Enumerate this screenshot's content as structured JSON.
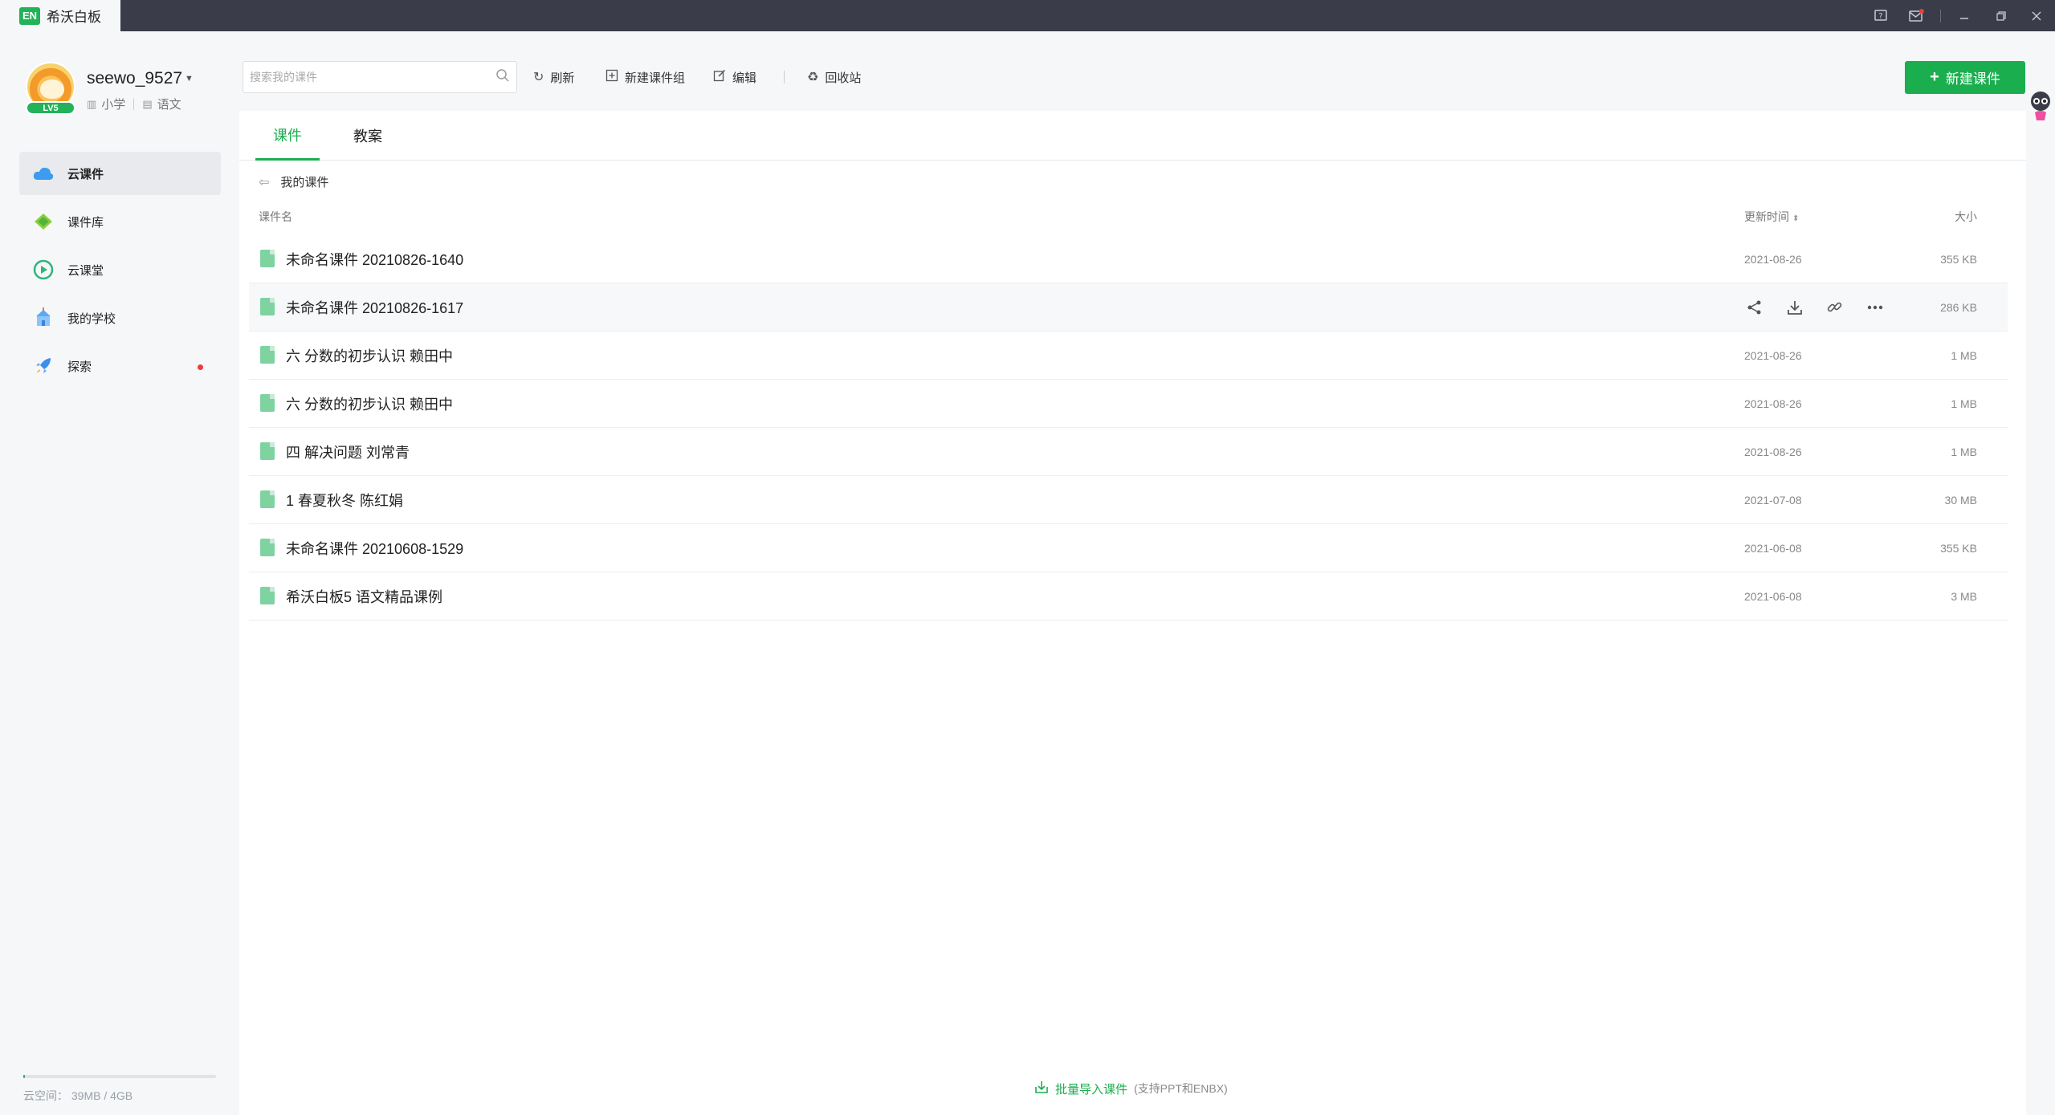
{
  "app": {
    "logo_text": "EN",
    "title": "希沃白板"
  },
  "user": {
    "name": "seewo_9527",
    "level": "LV5",
    "grade": "小学",
    "subject": "语文"
  },
  "sidebar": {
    "items": [
      {
        "label": "云课件",
        "active": true
      },
      {
        "label": "课件库"
      },
      {
        "label": "云课堂"
      },
      {
        "label": "我的学校"
      },
      {
        "label": "探索",
        "badge": true
      }
    ],
    "storage_text": "云空间：  39MB / 4GB",
    "storage_fraction": 0.01
  },
  "toolbar": {
    "search_placeholder": "搜索我的课件",
    "refresh": "刷新",
    "new_group": "新建课件组",
    "edit": "编辑",
    "recycle": "回收站",
    "new_courseware": "新建课件"
  },
  "tabs": [
    "课件",
    "教案"
  ],
  "breadcrumb": "我的课件",
  "table": {
    "columns": {
      "name": "课件名",
      "updated": "更新时间",
      "size": "大小"
    },
    "rows": [
      {
        "name": "未命名课件 20210826-1640",
        "date": "2021-08-26",
        "size": "355 KB"
      },
      {
        "name": "未命名课件 20210826-1617",
        "date": "",
        "size": "286 KB",
        "hover": true
      },
      {
        "name": "六 分数的初步认识 赖田中",
        "date": "2021-08-26",
        "size": "1 MB"
      },
      {
        "name": "六 分数的初步认识 赖田中",
        "date": "2021-08-26",
        "size": "1 MB"
      },
      {
        "name": "四 解决问题 刘常青",
        "date": "2021-08-26",
        "size": "1 MB"
      },
      {
        "name": "1 春夏秋冬 陈红娟",
        "date": "2021-07-08",
        "size": "30 MB"
      },
      {
        "name": "未命名课件 20210608-1529",
        "date": "2021-06-08",
        "size": "355 KB"
      },
      {
        "name": "希沃白板5 语文精品课例",
        "date": "2021-06-08",
        "size": "3 MB"
      }
    ]
  },
  "import": {
    "link": "批量导入课件",
    "hint": "(支持PPT和ENBX)"
  },
  "colors": {
    "accent": "#1bae4f",
    "titlebar": "#3a3c4a"
  }
}
